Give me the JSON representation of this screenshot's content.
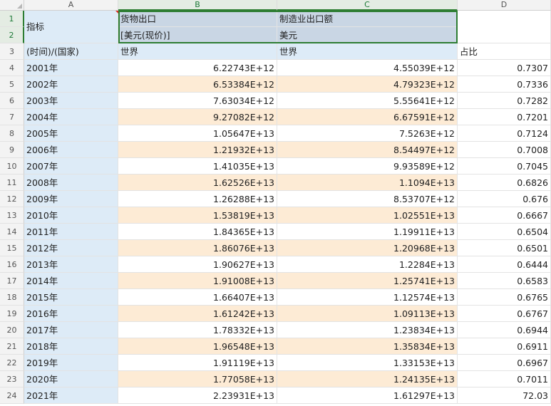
{
  "columns": [
    "A",
    "B",
    "C",
    "D"
  ],
  "header": {
    "a_label": "指标",
    "b_row1": "货物出口",
    "b_row2": "[美元(现价)]",
    "c_row1": "制造业出口额",
    "c_row2": "美元",
    "a3": "(时间)/(国家)",
    "b3": "世界",
    "c3": "世界",
    "d3": "占比"
  },
  "row_numbers": [
    "1",
    "2",
    "3",
    "4",
    "5",
    "6",
    "7",
    "8",
    "9",
    "10",
    "11",
    "12",
    "13",
    "14",
    "15",
    "16",
    "17",
    "18",
    "19",
    "20",
    "21",
    "22",
    "23",
    "24"
  ],
  "rows": [
    {
      "year": "2001年",
      "goods": "6.22743E+12",
      "mfg": "4.55039E+12",
      "ratio": "0.7307"
    },
    {
      "year": "2002年",
      "goods": "6.53384E+12",
      "mfg": "4.79323E+12",
      "ratio": "0.7336"
    },
    {
      "year": "2003年",
      "goods": "7.63034E+12",
      "mfg": "5.55641E+12",
      "ratio": "0.7282"
    },
    {
      "year": "2004年",
      "goods": "9.27082E+12",
      "mfg": "6.67591E+12",
      "ratio": "0.7201"
    },
    {
      "year": "2005年",
      "goods": "1.05647E+13",
      "mfg": "7.5263E+12",
      "ratio": "0.7124"
    },
    {
      "year": "2006年",
      "goods": "1.21932E+13",
      "mfg": "8.54497E+12",
      "ratio": "0.7008"
    },
    {
      "year": "2007年",
      "goods": "1.41035E+13",
      "mfg": "9.93589E+12",
      "ratio": "0.7045"
    },
    {
      "year": "2008年",
      "goods": "1.62526E+13",
      "mfg": "1.1094E+13",
      "ratio": "0.6826"
    },
    {
      "year": "2009年",
      "goods": "1.26288E+13",
      "mfg": "8.53707E+12",
      "ratio": "0.676"
    },
    {
      "year": "2010年",
      "goods": "1.53819E+13",
      "mfg": "1.02551E+13",
      "ratio": "0.6667"
    },
    {
      "year": "2011年",
      "goods": "1.84365E+13",
      "mfg": "1.19911E+13",
      "ratio": "0.6504"
    },
    {
      "year": "2012年",
      "goods": "1.86076E+13",
      "mfg": "1.20968E+13",
      "ratio": "0.6501"
    },
    {
      "year": "2013年",
      "goods": "1.90627E+13",
      "mfg": "1.2284E+13",
      "ratio": "0.6444"
    },
    {
      "year": "2014年",
      "goods": "1.91008E+13",
      "mfg": "1.25741E+13",
      "ratio": "0.6583"
    },
    {
      "year": "2015年",
      "goods": "1.66407E+13",
      "mfg": "1.12574E+13",
      "ratio": "0.6765"
    },
    {
      "year": "2016年",
      "goods": "1.61242E+13",
      "mfg": "1.09113E+13",
      "ratio": "0.6767"
    },
    {
      "year": "2017年",
      "goods": "1.78332E+13",
      "mfg": "1.23834E+13",
      "ratio": "0.6944"
    },
    {
      "year": "2018年",
      "goods": "1.96548E+13",
      "mfg": "1.35834E+13",
      "ratio": "0.6911"
    },
    {
      "year": "2019年",
      "goods": "1.91119E+13",
      "mfg": "1.33153E+13",
      "ratio": "0.6967"
    },
    {
      "year": "2020年",
      "goods": "1.77058E+13",
      "mfg": "1.24135E+13",
      "ratio": "0.7011"
    },
    {
      "year": "2021年",
      "goods": "2.23931E+13",
      "mfg": "1.61297E+13",
      "ratio": "72.03"
    }
  ],
  "colors": {
    "selection": "#2d7d32",
    "blue_fill": "#ddebf7",
    "blue_dark_fill": "#c9d6e4",
    "peach_fill": "#fdebd5"
  }
}
